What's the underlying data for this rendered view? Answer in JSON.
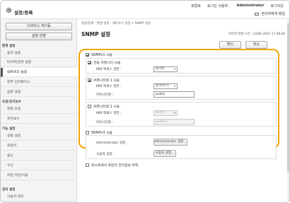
{
  "app": {
    "title": "설정/등록",
    "top_links": [
      "포탈로",
      "로그인 사용자 :",
      "Administrator",
      "로그아웃"
    ],
    "mail_link": "관리자에게 메일"
  },
  "sidebar": {
    "device_restart": "디바이스 재기동",
    "apply_settings": "설정 반영",
    "sections": [
      {
        "heading": "환경 설정",
        "items": [
          "용지 설정",
          "타이머/전력 설정",
          "네트워크 설정",
          "외부 인터페이스",
          "음량 설정"
        ]
      },
      {
        "heading": "조정/유지보수",
        "items": [
          "화질 조정",
          "유지보수"
        ]
      },
      {
        "heading": "기능 설정",
        "items": [
          "공통 설정",
          "프린터",
          "송신",
          "수신",
          "파일 저장/이용"
        ]
      },
      {
        "heading": "관리 설정",
        "items": [
          "사용자 관리"
        ]
      }
    ],
    "selected": "네트워크 설정"
  },
  "main": {
    "breadcrumb": "설정/등록 : 환경 설정 : 네트워크 설정 > SNMP 설정",
    "title": "SNMP 설정",
    "timestamp": "마지막 변경 시각 : 14/06 2021 17:48:26",
    "ok_label": "확인",
    "cancel_label": "취소",
    "snmpv1": {
      "label": "SNMPv1 사용",
      "checked": true,
      "dedicated_community": {
        "label": "전용 커뮤니티 사용",
        "checked": true,
        "mib_label": "MIB 액세스 권한 :",
        "mib_value": "읽기만"
      },
      "community1": {
        "label": "커뮤니티명 1 사용",
        "checked": true,
        "mib_label": "MIB 액세스 권한 :",
        "mib_value": "읽기/쓰기",
        "name_label": "커뮤니티명 :",
        "name_value": "public"
      },
      "community2": {
        "label": "커뮤니티명 2 사용",
        "checked": false,
        "mib_label": "MIB 액세스 권한 :",
        "mib_value": "읽기만",
        "name_label": "커뮤니티명 :",
        "name_value": "public2"
      }
    },
    "snmpv3": {
      "label": "SNMPv3 사용",
      "checked": false,
      "admin_label": "Administrator 설정 :",
      "admin_button": "Administrator 설정...",
      "user_label": "사용자 설정 :",
      "user_button": "사용자 설정..."
    },
    "host_info": {
      "label": "호스트에서 프린터 관리정보 취득",
      "checked": false
    }
  },
  "colors": {
    "highlight": "#f0a500"
  }
}
